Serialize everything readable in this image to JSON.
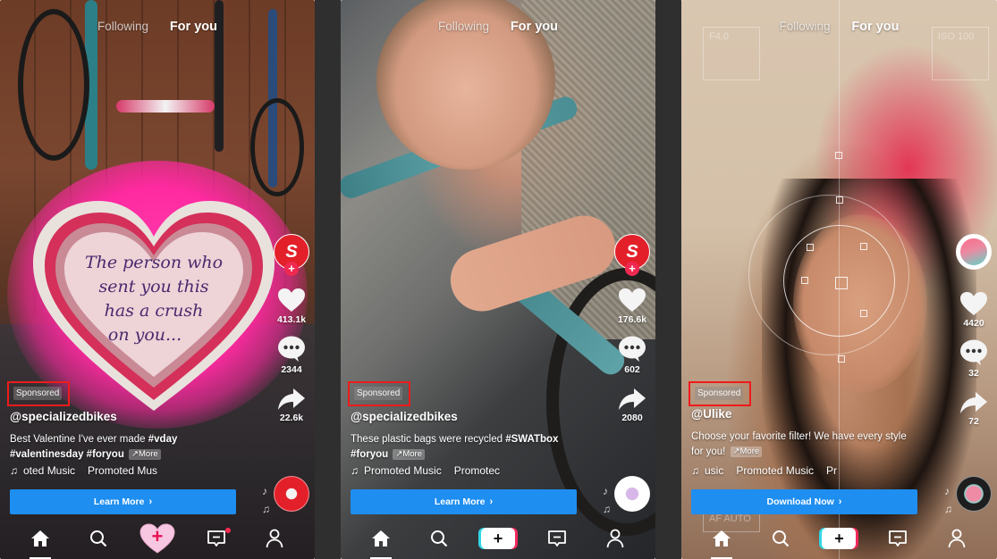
{
  "panels": [
    {
      "top_tabs": {
        "following": "Following",
        "for_you": "For you"
      },
      "heart_card_text": [
        "The person who",
        "sent you this",
        "has a crush",
        "on you..."
      ],
      "sponsored_label": "Sponsored",
      "username": "@specializedbikes",
      "caption": {
        "text_line1": "Best Valentine I've ever made ",
        "tag1": "#vday",
        "tag2": "#valentinesday",
        "tag3": "#foryou",
        "more_label": "↗More"
      },
      "music": {
        "icon": "music-note",
        "part1": "oted Music",
        "part2": "Promoted Mus"
      },
      "cta_label": "Learn More",
      "sidebar": {
        "avatar_glyph": "S",
        "likes": "413.1k",
        "comments": "2344",
        "shares": "22.6k"
      },
      "nav": [
        "Home",
        "Discover",
        "Create",
        "Inbox",
        "Profile"
      ],
      "inbox_badge": true,
      "create_style": "candy-heart"
    },
    {
      "top_tabs": {
        "following": "Following",
        "for_you": "For you"
      },
      "sponsored_label": "Sponsored",
      "username": "@specializedbikes",
      "caption": {
        "text_line1": "These plastic bags were recycled ",
        "tag1": "#SWATbox",
        "tag2": "#foryou",
        "more_label": "↗More"
      },
      "music": {
        "icon": "music-note",
        "part1": "Promoted Music",
        "part2": "Promotec"
      },
      "cta_label": "Learn More",
      "sidebar": {
        "avatar_glyph": "S",
        "likes": "176.6k",
        "comments": "602",
        "shares": "2080"
      },
      "nav": [
        "Home",
        "Discover",
        "Create",
        "Inbox",
        "Profile"
      ],
      "inbox_badge": false,
      "create_style": "default"
    },
    {
      "top_tabs": {
        "following": "Following",
        "for_you": "For you"
      },
      "camera_overlay": {
        "af_label": "AF AUTO",
        "iso_label": "ISO 100",
        "f_label": "F4.0"
      },
      "sponsored_label": "Sponsored",
      "username": "@Ulike",
      "caption": {
        "text_line1": "Choose your favorite filter! We have every style",
        "text_line2": "for you!",
        "more_label": "↗More"
      },
      "music": {
        "icon": "music-note",
        "part1": "usic",
        "part2": "Promoted Music",
        "part3": "Pr"
      },
      "cta_label": "Download Now",
      "sidebar": {
        "likes": "4420",
        "comments": "32",
        "shares": "72"
      },
      "nav": [
        "Home",
        "Discover",
        "Create",
        "Inbox",
        "Profile"
      ],
      "inbox_badge": false,
      "create_style": "default"
    }
  ],
  "colors": {
    "sponsored_highlight": "#ee1b1b",
    "cta_blue": "#1e8ef0",
    "specialized_red": "#e3202a",
    "follow_pink": "#ef2950",
    "tiktok_cyan": "#32d5e6",
    "tiktok_pink": "#f1295b"
  }
}
